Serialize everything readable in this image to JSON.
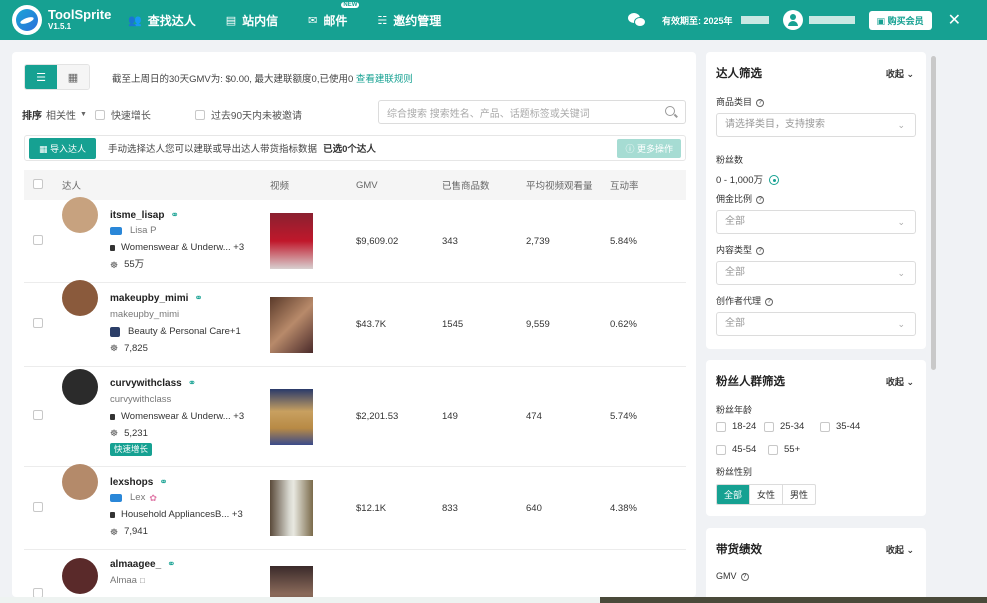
{
  "app": {
    "name": "ToolSprite",
    "version": "V1.5.1"
  },
  "nav": [
    {
      "label": "查找达人",
      "icon": "users-icon"
    },
    {
      "label": "站内信",
      "icon": "message-icon"
    },
    {
      "label": "邮件",
      "icon": "mail-icon",
      "badge": "NEW"
    },
    {
      "label": "邀约管理",
      "icon": "org-icon"
    }
  ],
  "header": {
    "expire_label": "有效期至: 2025年",
    "buy_label": "购买会员",
    "close": "✕"
  },
  "toolbar": {
    "gmv_note": "截至上周日的30天GMV为: $0.00, 最大建联额度0,已使用0 ",
    "gmv_link": "查看建联规则",
    "sort_label": "排序",
    "sort_value": "相关性",
    "chk_fast": "快速增长",
    "chk_90": "过去90天内未被邀请",
    "search_placeholder": "综合搜索 搜索姓名、产品、话题标签或关键词",
    "import_label": "导入达人",
    "action_desc": "手动选择达人您可以建联或导出达人带货指标数据",
    "selected": "已选0个达人",
    "more_label": "更多操作"
  },
  "table": {
    "columns": [
      "达人",
      "视频",
      "GMV",
      "已售商品数",
      "平均视频观看量",
      "互动率"
    ],
    "rows": [
      {
        "handle": "itsme_lisap",
        "name": "Lisa P",
        "name_icon": "blue",
        "category": "Womenswear & Underw... +3",
        "followers": "55万",
        "gmv": "$9,609.02",
        "sold": "343",
        "views": "2,739",
        "rate": "5.84%",
        "avatar_color": "#c7a27f",
        "thumb_color": "#c0182b",
        "badge": ""
      },
      {
        "handle": "makeupby_mimi",
        "name": "makeupby_mimi",
        "name_icon": "",
        "category": "Beauty & Personal Care+1",
        "followers": "7,825",
        "gmv": "$43.7K",
        "sold": "1545",
        "views": "9,559",
        "rate": "0.62%",
        "avatar_color": "#8a5a3c",
        "thumb_color": "#7a4a3a",
        "badge": ""
      },
      {
        "handle": "curvywithclass",
        "name": "curvywithclass",
        "name_icon": "",
        "category": "Womenswear & Underw... +3",
        "followers": "5,231",
        "gmv": "$2,201.53",
        "sold": "149",
        "views": "474",
        "rate": "5.74%",
        "avatar_color": "#2b2b2b",
        "thumb_color": "#b88a55",
        "badge": "快速增长"
      },
      {
        "handle": "lexshops",
        "name": "Lex",
        "name_icon": "blue",
        "category": "Household AppliancesB... +3",
        "followers": "7,941",
        "gmv": "$12.1K",
        "sold": "833",
        "views": "640",
        "rate": "4.38%",
        "avatar_color": "#b48a6a",
        "thumb_color": "#9a8a7a",
        "badge": ""
      },
      {
        "handle": "almaagee_",
        "name": "Almaa",
        "name_icon": "",
        "category": "",
        "followers": "",
        "gmv": "",
        "sold": "",
        "views": "",
        "rate": "",
        "avatar_color": "#5a2a2a",
        "thumb_color": "#6a4a4a",
        "badge": ""
      }
    ]
  },
  "filters": {
    "title": "达人筛选",
    "collapse": "收起",
    "category_label": "商品类目",
    "category_placeholder": "请选择类目，支持搜索",
    "fans_label": "粉丝数",
    "fans_range": "0  -  1,000万",
    "commission_label": "佣金比例",
    "commission_value": "全部",
    "content_label": "内容类型",
    "content_value": "全部",
    "agency_label": "创作者代理",
    "agency_value": "全部"
  },
  "audience": {
    "title": "粉丝人群筛选",
    "collapse": "收起",
    "age_label": "粉丝年龄",
    "ages": [
      "18-24",
      "25-34",
      "35-44",
      "45-54",
      "55+"
    ],
    "gender_label": "粉丝性别",
    "genders": [
      "全部",
      "女性",
      "男性"
    ]
  },
  "performance": {
    "title": "带货绩效",
    "collapse": "收起",
    "gmv_label": "GMV"
  },
  "colors": {
    "accent": "#16a192"
  }
}
